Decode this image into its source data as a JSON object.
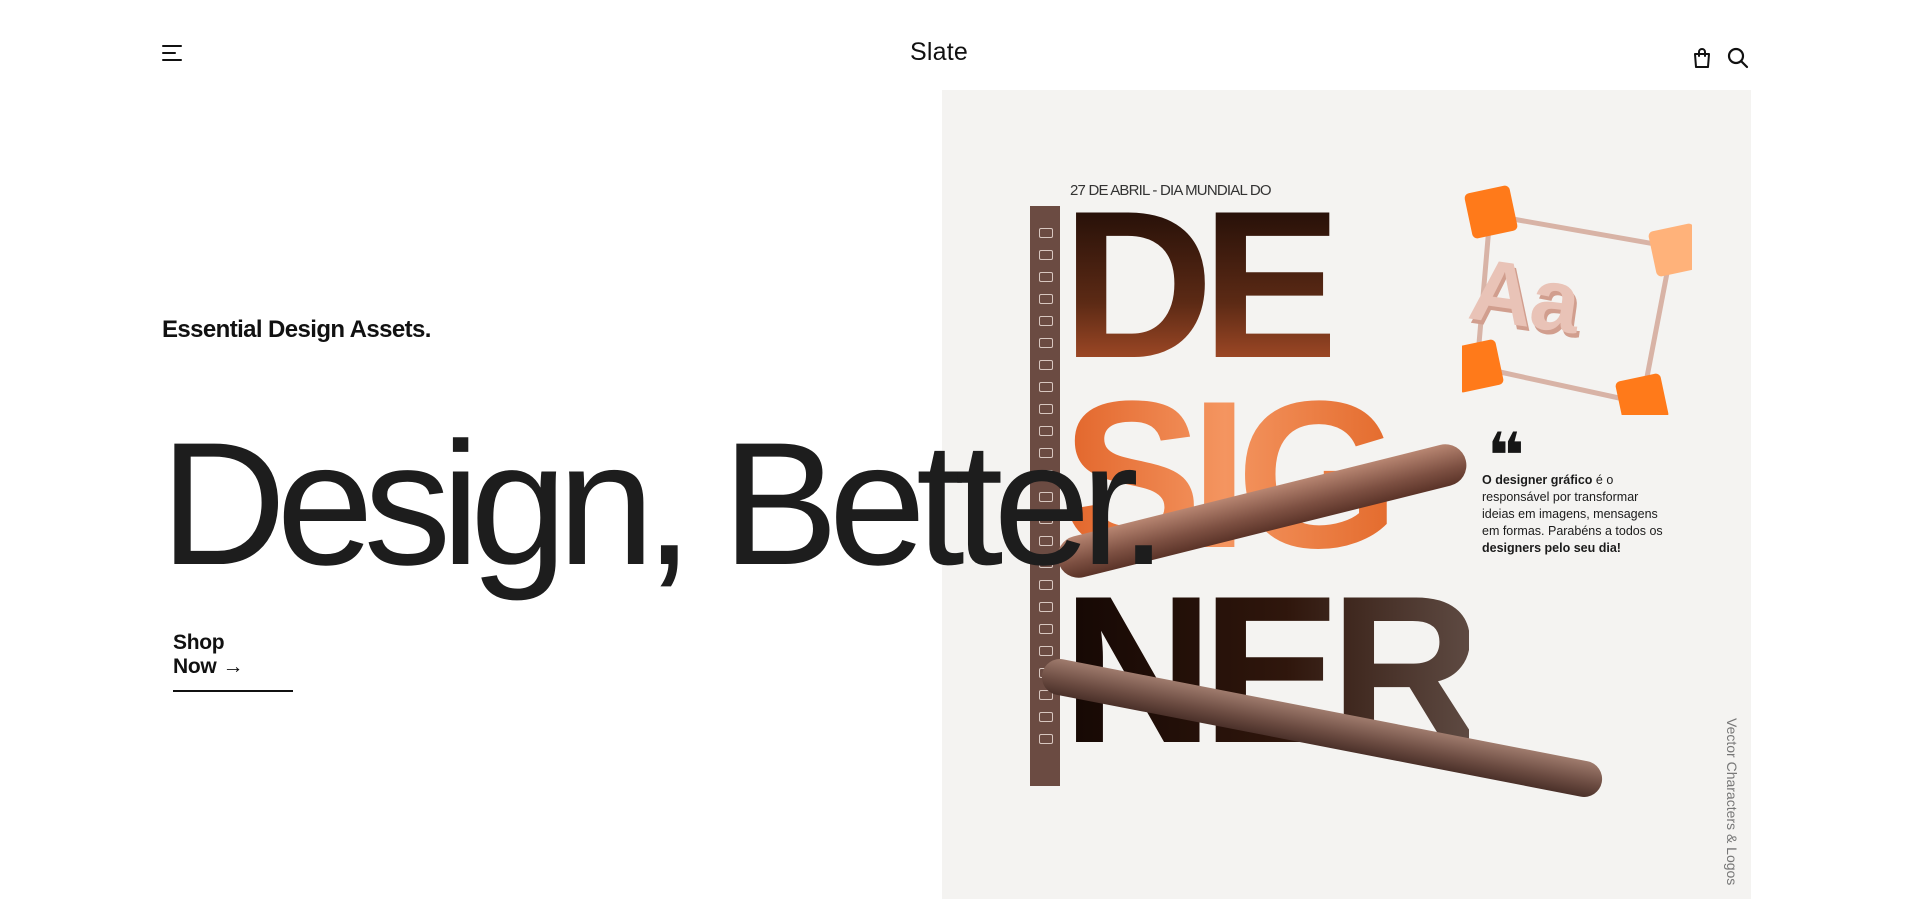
{
  "header": {
    "logo": "Slate",
    "menu_icon": "hamburger-menu-icon",
    "cart_icon": "shopping-bag-icon",
    "search_icon": "search-icon"
  },
  "hero": {
    "tagline": "Essential Design Assets.",
    "headline": "Design, Better.",
    "cta_label": "Shop Now",
    "cta_arrow": "→"
  },
  "artwork": {
    "date_line": "27 DE ABRIL - DIA MUNDIAL DO",
    "word_de": "DE",
    "word_sig": "SIG",
    "word_ner": "NER",
    "artboard_glyphs": "Aa",
    "quote_mark": "❝",
    "quote_bold_lead": "O designer gráfico",
    "quote_body": " é o responsável por transformar ideias em imagens, mensagens em formas. Parabéns a todos os ",
    "quote_bold_tail": "designers pelo seu dia!",
    "side_credit": "Vector Characters & Logos"
  },
  "colors": {
    "background": "#ffffff",
    "text": "#1a1a1a",
    "accent_orange": "#f07a38",
    "toolbar": "#6b4b42"
  }
}
